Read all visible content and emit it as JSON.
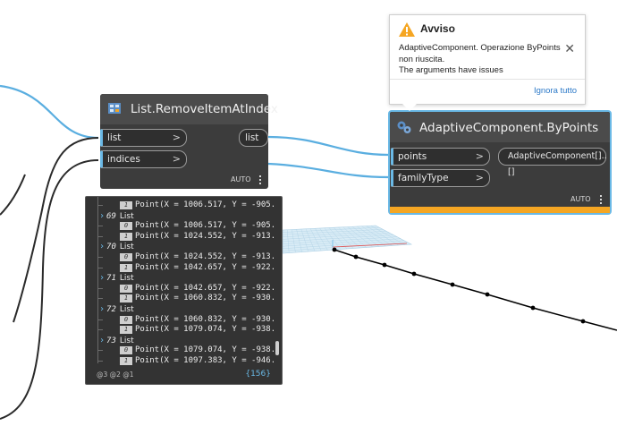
{
  "nodes": {
    "remove_item": {
      "title": "List.RemoveItemAtIndex",
      "inputs": [
        "list",
        "indices"
      ],
      "output": "list",
      "lacing": "AUTO"
    },
    "adaptive": {
      "title": "AdaptiveComponent.ByPoints",
      "inputs": [
        "points",
        "familyType"
      ],
      "output": "AdaptiveComponent[]..[]",
      "lacing": "AUTO",
      "state": "warning",
      "accent_color": "#f5a623",
      "selection_color": "#6ab9e6"
    }
  },
  "warning": {
    "title": "Avviso",
    "icon": "warning-triangle-icon",
    "message_lines": [
      "AdaptiveComponent. Operazione ByPoints",
      "non riuscita.",
      "The arguments have issues"
    ],
    "dismiss_label": "Ignora tutto"
  },
  "watch": {
    "rows": [
      {
        "kind": "item",
        "index": "1",
        "text": "Point(X = 1006.517, Y = -905."
      },
      {
        "kind": "group",
        "index": "69",
        "label": "List"
      },
      {
        "kind": "item",
        "index": "0",
        "text": "Point(X = 1006.517, Y = -905."
      },
      {
        "kind": "item",
        "index": "1",
        "text": "Point(X = 1024.552, Y = -913."
      },
      {
        "kind": "group",
        "index": "70",
        "label": "List"
      },
      {
        "kind": "item",
        "index": "0",
        "text": "Point(X = 1024.552, Y = -913."
      },
      {
        "kind": "item",
        "index": "1",
        "text": "Point(X = 1042.657, Y = -922."
      },
      {
        "kind": "group",
        "index": "71",
        "label": "List"
      },
      {
        "kind": "item",
        "index": "0",
        "text": "Point(X = 1042.657, Y = -922."
      },
      {
        "kind": "item",
        "index": "1",
        "text": "Point(X = 1060.832, Y = -930."
      },
      {
        "kind": "group",
        "index": "72",
        "label": "List"
      },
      {
        "kind": "item",
        "index": "0",
        "text": "Point(X = 1060.832, Y = -930."
      },
      {
        "kind": "item",
        "index": "1",
        "text": "Point(X = 1079.074, Y = -938."
      },
      {
        "kind": "group",
        "index": "73",
        "label": "List"
      },
      {
        "kind": "item",
        "index": "0",
        "text": "Point(X = 1079.074, Y = -938."
      },
      {
        "kind": "item",
        "index": "1",
        "text": "Point(X = 1097.383, Y = -946."
      }
    ],
    "levels": "@3 @2 @1",
    "count": "{156}"
  },
  "colors": {
    "wire": "#5aaee0",
    "canvas": "#ffffff",
    "node_body": "#3c3c3c",
    "grid": "#a9cde3"
  }
}
